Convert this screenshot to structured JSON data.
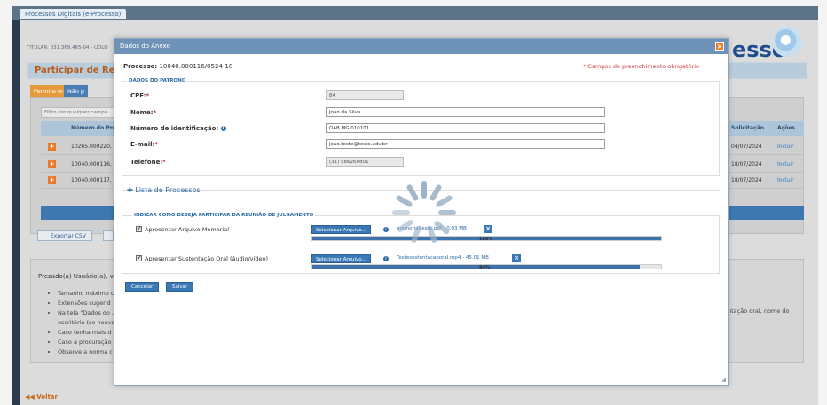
{
  "browser": {
    "tab_label": "Processos Digitais (e-Processo)"
  },
  "background": {
    "titular": "TITULAR: 031.369.465-04 - UOLO",
    "logo_text": "esso",
    "participar_title": "Participar de Reunião",
    "tab_permite": "Permite envio",
    "tab_nao": "Não p",
    "filter_placeholder": "Filtro por qualquer campo",
    "table": {
      "header_num": "Número do Pro",
      "header_solicitacao": "Solicitação",
      "header_acoes": "Ações",
      "rows": [
        {
          "num": "10265.000220,",
          "date": "04/07/2024",
          "action": "Incluir"
        },
        {
          "num": "10040.000116,",
          "date": "18/07/2024",
          "action": "Incluir"
        },
        {
          "num": "10040.000117,",
          "date": "18/07/2024",
          "action": "Incluir"
        }
      ]
    },
    "export_label": "Exportar CSV",
    "prezado": "Prezado(a) Usuário(a), vo",
    "bullets": [
      "Tamanho máximo c",
      "Extensões sugerid",
      "Na tela \"Dados do ,",
      "escritório (se houve",
      "Caso tenha mais d",
      "Caso a procuração",
      "Observe a norma c"
    ],
    "side_text": "ntação oral, nome do",
    "voltar": "Voltar"
  },
  "dialog": {
    "title": "Dados do Anexo",
    "processo_label": "Processo:",
    "processo_value": "10040.000116/0524-18",
    "required_note": "* Campos de preenchimento obrigatório",
    "patrono_legend": "DADOS DO PATRONO",
    "fields": {
      "cpf_label": "CPF:",
      "cpf_value": "84",
      "nome_label": "Nome:",
      "nome_value": "João da Silva",
      "num_id_label": "Número de identificação:",
      "num_id_value": "OAB MG 010101",
      "email_label": "E-mail:",
      "email_value": "joao.teste@teste.adv.br",
      "telefone_label": "Telefone:",
      "telefone_value": "(31) 986260801"
    },
    "lista_label": "Lista de Processos",
    "indicar_legend": "INDICAR COMO DESEJA PARTICIPAR DA REUNIÃO DE JULGAMENTO",
    "options": [
      {
        "label": "Apresentar Arquivo Memorial",
        "select_label": "Selecionar Arquivo...",
        "file": "memorialteste.pdf - 0.03 MB",
        "progress_text": "100%",
        "progress": 1.0
      },
      {
        "label": "Apresentar Sustentação Oral (áudio/vídeo)",
        "select_label": "Selecionar Arquivo...",
        "file": "Testesustentacaooral.mp4 - 45.01 MB",
        "progress_text": "94%",
        "progress": 0.94
      }
    ],
    "cancel_label": "Cancelar",
    "save_label": "Salvar"
  },
  "colors": {
    "accent_blue": "#3a78b6",
    "accent_orange": "#e77b2a",
    "required_red": "#d23a3a"
  }
}
